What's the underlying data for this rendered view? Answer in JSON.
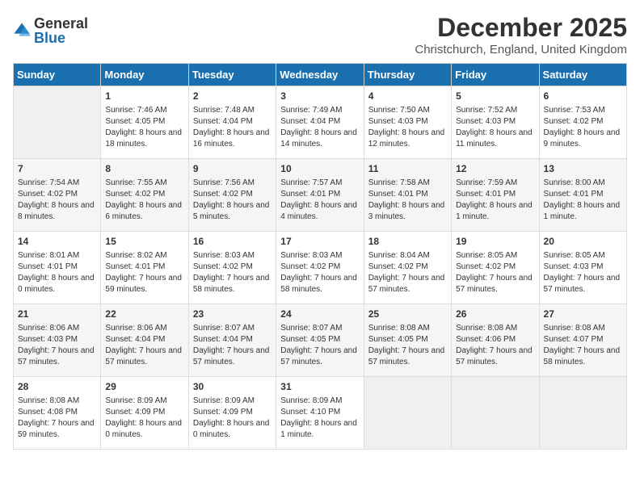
{
  "logo": {
    "general": "General",
    "blue": "Blue"
  },
  "title": "December 2025",
  "location": "Christchurch, England, United Kingdom",
  "days_of_week": [
    "Sunday",
    "Monday",
    "Tuesday",
    "Wednesday",
    "Thursday",
    "Friday",
    "Saturday"
  ],
  "weeks": [
    [
      {
        "day": "",
        "sunrise": "",
        "sunset": "",
        "daylight": ""
      },
      {
        "day": "1",
        "sunrise": "Sunrise: 7:46 AM",
        "sunset": "Sunset: 4:05 PM",
        "daylight": "Daylight: 8 hours and 18 minutes."
      },
      {
        "day": "2",
        "sunrise": "Sunrise: 7:48 AM",
        "sunset": "Sunset: 4:04 PM",
        "daylight": "Daylight: 8 hours and 16 minutes."
      },
      {
        "day": "3",
        "sunrise": "Sunrise: 7:49 AM",
        "sunset": "Sunset: 4:04 PM",
        "daylight": "Daylight: 8 hours and 14 minutes."
      },
      {
        "day": "4",
        "sunrise": "Sunrise: 7:50 AM",
        "sunset": "Sunset: 4:03 PM",
        "daylight": "Daylight: 8 hours and 12 minutes."
      },
      {
        "day": "5",
        "sunrise": "Sunrise: 7:52 AM",
        "sunset": "Sunset: 4:03 PM",
        "daylight": "Daylight: 8 hours and 11 minutes."
      },
      {
        "day": "6",
        "sunrise": "Sunrise: 7:53 AM",
        "sunset": "Sunset: 4:02 PM",
        "daylight": "Daylight: 8 hours and 9 minutes."
      }
    ],
    [
      {
        "day": "7",
        "sunrise": "Sunrise: 7:54 AM",
        "sunset": "Sunset: 4:02 PM",
        "daylight": "Daylight: 8 hours and 8 minutes."
      },
      {
        "day": "8",
        "sunrise": "Sunrise: 7:55 AM",
        "sunset": "Sunset: 4:02 PM",
        "daylight": "Daylight: 8 hours and 6 minutes."
      },
      {
        "day": "9",
        "sunrise": "Sunrise: 7:56 AM",
        "sunset": "Sunset: 4:02 PM",
        "daylight": "Daylight: 8 hours and 5 minutes."
      },
      {
        "day": "10",
        "sunrise": "Sunrise: 7:57 AM",
        "sunset": "Sunset: 4:01 PM",
        "daylight": "Daylight: 8 hours and 4 minutes."
      },
      {
        "day": "11",
        "sunrise": "Sunrise: 7:58 AM",
        "sunset": "Sunset: 4:01 PM",
        "daylight": "Daylight: 8 hours and 3 minutes."
      },
      {
        "day": "12",
        "sunrise": "Sunrise: 7:59 AM",
        "sunset": "Sunset: 4:01 PM",
        "daylight": "Daylight: 8 hours and 1 minute."
      },
      {
        "day": "13",
        "sunrise": "Sunrise: 8:00 AM",
        "sunset": "Sunset: 4:01 PM",
        "daylight": "Daylight: 8 hours and 1 minute."
      }
    ],
    [
      {
        "day": "14",
        "sunrise": "Sunrise: 8:01 AM",
        "sunset": "Sunset: 4:01 PM",
        "daylight": "Daylight: 8 hours and 0 minutes."
      },
      {
        "day": "15",
        "sunrise": "Sunrise: 8:02 AM",
        "sunset": "Sunset: 4:01 PM",
        "daylight": "Daylight: 7 hours and 59 minutes."
      },
      {
        "day": "16",
        "sunrise": "Sunrise: 8:03 AM",
        "sunset": "Sunset: 4:02 PM",
        "daylight": "Daylight: 7 hours and 58 minutes."
      },
      {
        "day": "17",
        "sunrise": "Sunrise: 8:03 AM",
        "sunset": "Sunset: 4:02 PM",
        "daylight": "Daylight: 7 hours and 58 minutes."
      },
      {
        "day": "18",
        "sunrise": "Sunrise: 8:04 AM",
        "sunset": "Sunset: 4:02 PM",
        "daylight": "Daylight: 7 hours and 57 minutes."
      },
      {
        "day": "19",
        "sunrise": "Sunrise: 8:05 AM",
        "sunset": "Sunset: 4:02 PM",
        "daylight": "Daylight: 7 hours and 57 minutes."
      },
      {
        "day": "20",
        "sunrise": "Sunrise: 8:05 AM",
        "sunset": "Sunset: 4:03 PM",
        "daylight": "Daylight: 7 hours and 57 minutes."
      }
    ],
    [
      {
        "day": "21",
        "sunrise": "Sunrise: 8:06 AM",
        "sunset": "Sunset: 4:03 PM",
        "daylight": "Daylight: 7 hours and 57 minutes."
      },
      {
        "day": "22",
        "sunrise": "Sunrise: 8:06 AM",
        "sunset": "Sunset: 4:04 PM",
        "daylight": "Daylight: 7 hours and 57 minutes."
      },
      {
        "day": "23",
        "sunrise": "Sunrise: 8:07 AM",
        "sunset": "Sunset: 4:04 PM",
        "daylight": "Daylight: 7 hours and 57 minutes."
      },
      {
        "day": "24",
        "sunrise": "Sunrise: 8:07 AM",
        "sunset": "Sunset: 4:05 PM",
        "daylight": "Daylight: 7 hours and 57 minutes."
      },
      {
        "day": "25",
        "sunrise": "Sunrise: 8:08 AM",
        "sunset": "Sunset: 4:05 PM",
        "daylight": "Daylight: 7 hours and 57 minutes."
      },
      {
        "day": "26",
        "sunrise": "Sunrise: 8:08 AM",
        "sunset": "Sunset: 4:06 PM",
        "daylight": "Daylight: 7 hours and 57 minutes."
      },
      {
        "day": "27",
        "sunrise": "Sunrise: 8:08 AM",
        "sunset": "Sunset: 4:07 PM",
        "daylight": "Daylight: 7 hours and 58 minutes."
      }
    ],
    [
      {
        "day": "28",
        "sunrise": "Sunrise: 8:08 AM",
        "sunset": "Sunset: 4:08 PM",
        "daylight": "Daylight: 7 hours and 59 minutes."
      },
      {
        "day": "29",
        "sunrise": "Sunrise: 8:09 AM",
        "sunset": "Sunset: 4:09 PM",
        "daylight": "Daylight: 8 hours and 0 minutes."
      },
      {
        "day": "30",
        "sunrise": "Sunrise: 8:09 AM",
        "sunset": "Sunset: 4:09 PM",
        "daylight": "Daylight: 8 hours and 0 minutes."
      },
      {
        "day": "31",
        "sunrise": "Sunrise: 8:09 AM",
        "sunset": "Sunset: 4:10 PM",
        "daylight": "Daylight: 8 hours and 1 minute."
      },
      {
        "day": "",
        "sunrise": "",
        "sunset": "",
        "daylight": ""
      },
      {
        "day": "",
        "sunrise": "",
        "sunset": "",
        "daylight": ""
      },
      {
        "day": "",
        "sunrise": "",
        "sunset": "",
        "daylight": ""
      }
    ]
  ],
  "colors": {
    "header_bg": "#1a6faf",
    "header_text": "#ffffff",
    "row_odd": "#ffffff",
    "row_even": "#f5f5f5"
  }
}
